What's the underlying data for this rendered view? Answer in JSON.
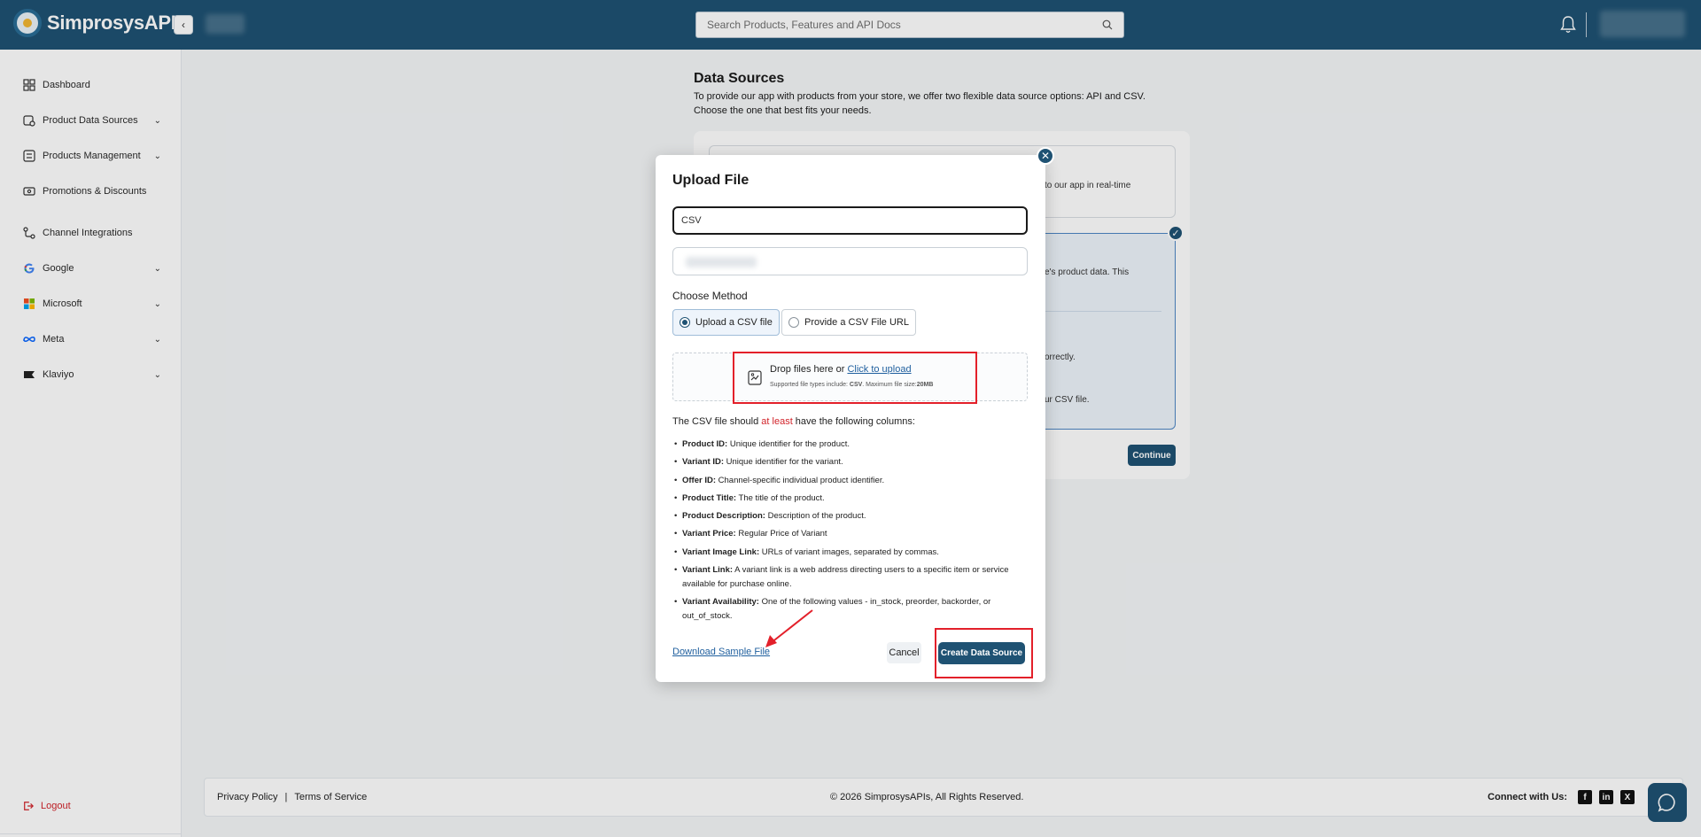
{
  "brand": {
    "name": "SimprosysAPIs"
  },
  "header": {
    "search_placeholder": "Search Products, Features and API Docs"
  },
  "sidebar": {
    "items": [
      {
        "label": "Dashboard",
        "icon": "grid-icon"
      },
      {
        "label": "Product Data Sources",
        "icon": "data-source-icon",
        "expandable": true
      },
      {
        "label": "Products Management",
        "icon": "list-icon",
        "expandable": true
      },
      {
        "label": "Promotions & Discounts",
        "icon": "tag-icon"
      },
      {
        "label": "Channel Integrations",
        "icon": "integration-icon"
      },
      {
        "label": "Google",
        "icon": "google-icon",
        "expandable": true
      },
      {
        "label": "Microsoft",
        "icon": "microsoft-icon",
        "expandable": true
      },
      {
        "label": "Meta",
        "icon": "meta-icon",
        "expandable": true
      },
      {
        "label": "Klaviyo",
        "icon": "klaviyo-icon",
        "expandable": true
      }
    ],
    "logout": "Logout"
  },
  "page": {
    "title": "Data Sources",
    "description": "To provide our app with products from your store, we offer two flexible data source options: API and CSV. Choose the one that best fits your needs.",
    "snippets": {
      "card1": "to our app in real-time",
      "card2_line1": "e's product data. This",
      "card2_line2": "orrectly.",
      "card2_line3": "ur CSV file."
    },
    "continue_label": "Continue"
  },
  "modal": {
    "title": "Upload File",
    "type_value": "CSV",
    "method_label": "Choose Method",
    "methods": [
      {
        "label": "Upload a CSV file",
        "selected": true
      },
      {
        "label": "Provide a CSV File URL",
        "selected": false
      }
    ],
    "dropzone": {
      "text": "Drop files here or ",
      "link": "Click to upload",
      "sub_prefix": "Supported file types include: ",
      "sub_type": "CSV",
      "sub_middle": ". Maximum file size:",
      "sub_size": "20MB"
    },
    "requirements_intro_pre": "The CSV file should ",
    "requirements_intro_em": "at least",
    "requirements_intro_post": " have the following columns:",
    "columns": [
      {
        "name": "Product ID:",
        "desc": " Unique identifier for the product."
      },
      {
        "name": "Variant ID:",
        "desc": " Unique identifier for the variant."
      },
      {
        "name": "Offer ID:",
        "desc": " Channel-specific individual product identifier."
      },
      {
        "name": "Product Title:",
        "desc": " The title of the product."
      },
      {
        "name": "Product Description:",
        "desc": " Description of the product."
      },
      {
        "name": "Variant Price:",
        "desc": " Regular Price of Variant"
      },
      {
        "name": "Variant Image Link:",
        "desc": " URLs of variant images, separated by commas."
      },
      {
        "name": "Variant Link:",
        "desc": " A variant link is a web address directing users to a specific item or service available for purchase online."
      },
      {
        "name": "Variant Availability:",
        "desc": " One of the following values - in_stock, preorder, backorder, or out_of_stock."
      }
    ],
    "download_label": "Download Sample File",
    "cancel_label": "Cancel",
    "create_label": "Create Data Source"
  },
  "footer": {
    "privacy": "Privacy Policy",
    "separator": "|",
    "terms": "Terms of Service",
    "copyright": "© 2026 SimprosysAPIs, All Rights Reserved.",
    "connect": "Connect with Us:",
    "social": [
      "facebook-icon",
      "linkedin-icon",
      "x-icon"
    ]
  },
  "colors": {
    "brand": "#1f5273",
    "annotation": "#e3202a",
    "link": "#1f5f9e"
  }
}
